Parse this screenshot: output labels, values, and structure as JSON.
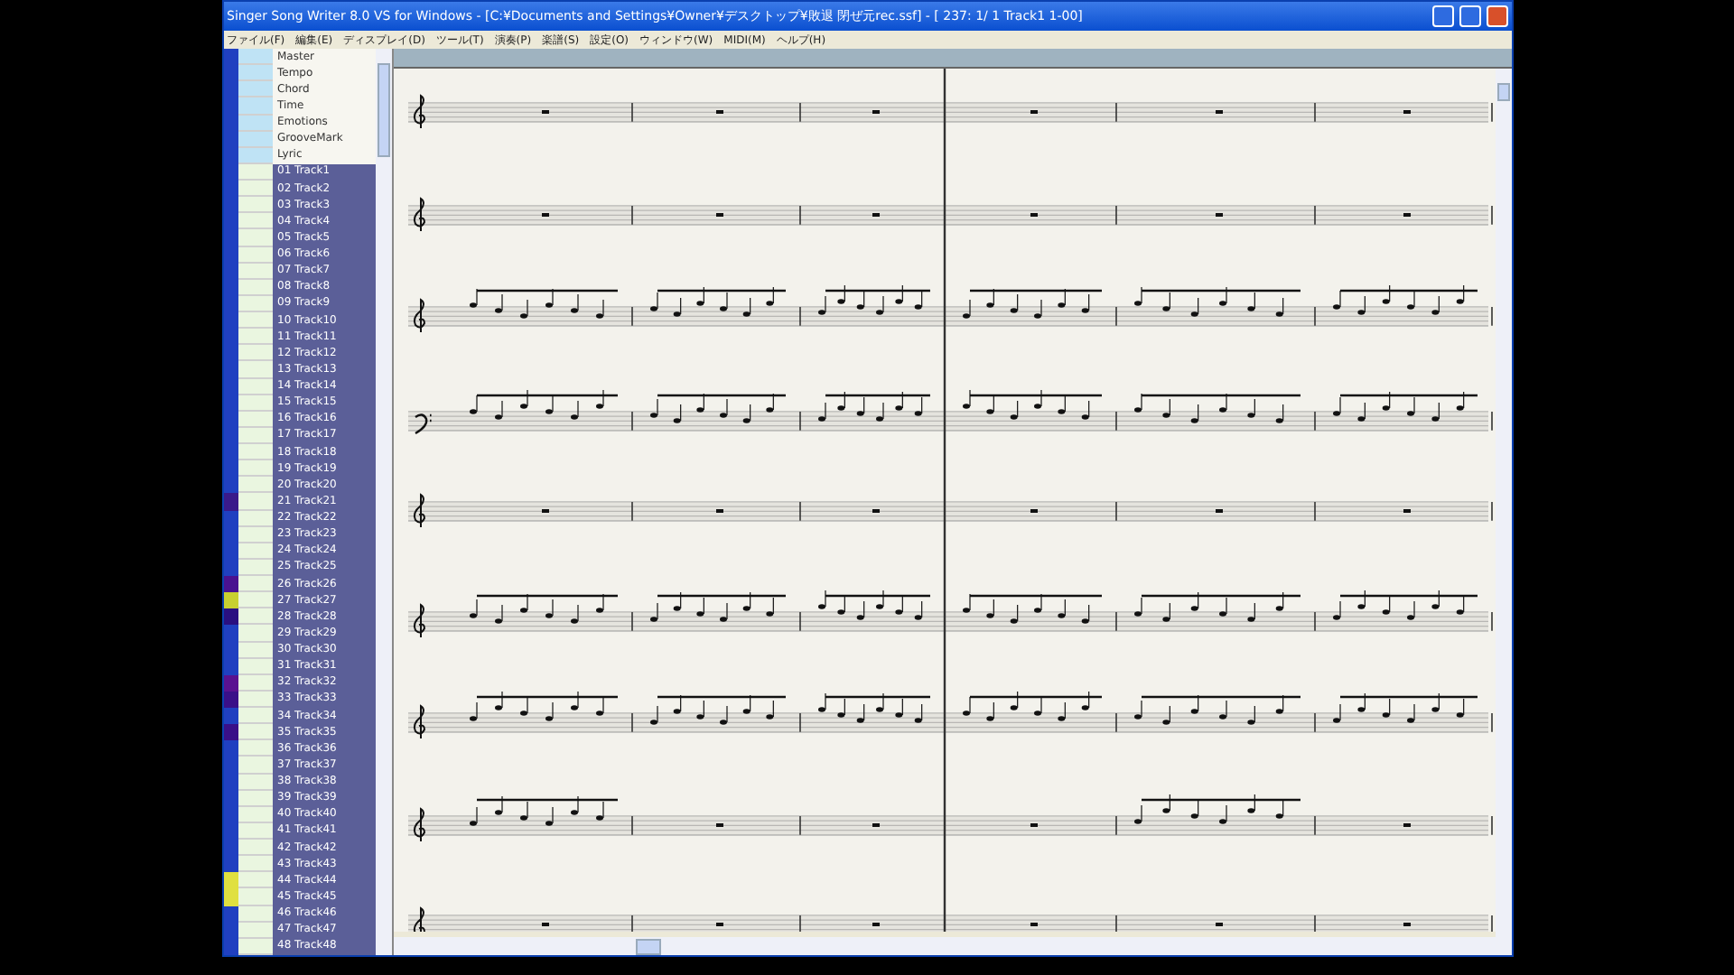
{
  "window": {
    "title": "Singer Song Writer 8.0 VS for Windows - [C:¥Documents and Settings¥Owner¥デスクトップ¥敗退 閉ぜ元rec.ssf] - [ 237: 1/ 1 Track1 1-00]"
  },
  "menu": [
    "ファイル(F)",
    "編集(E)",
    "ディスプレイ(D)",
    "ツール(T)",
    "演奏(P)",
    "楽譜(S)",
    "設定(O)",
    "ウィンドウ(W)",
    "MIDI(M)",
    "ヘルプ(H)"
  ],
  "track_list": {
    "meta": [
      "Master",
      "Tempo",
      "Chord",
      "Time",
      "Emotions",
      "GrooveMark",
      "Lyric"
    ],
    "tracks": [
      {
        "name": "01 Track1"
      },
      {
        "name": "02 Track2"
      },
      {
        "name": "03 Track3"
      },
      {
        "name": "04 Track4"
      },
      {
        "name": "05 Track5"
      },
      {
        "name": "06 Track6"
      },
      {
        "name": "07 Track7"
      },
      {
        "name": "08 Track8"
      },
      {
        "name": "09 Track9"
      },
      {
        "name": "10 Track10"
      },
      {
        "name": "11 Track11"
      },
      {
        "name": "12 Track12"
      },
      {
        "name": "13 Track13"
      },
      {
        "name": "14 Track14"
      },
      {
        "name": "15 Track15"
      },
      {
        "name": "16 Track16"
      },
      {
        "name": "17 Track17"
      },
      {
        "name": "18 Track18"
      },
      {
        "name": "19 Track19"
      },
      {
        "name": "20 Track20"
      },
      {
        "name": "21 Track21",
        "color": "#3a1a8a"
      },
      {
        "name": "22 Track22"
      },
      {
        "name": "23 Track23"
      },
      {
        "name": "24 Track24"
      },
      {
        "name": "25 Track25"
      },
      {
        "name": "26 Track26",
        "color": "#4a1290"
      },
      {
        "name": "27 Track27",
        "color": "#c8d030"
      },
      {
        "name": "28 Track28",
        "color": "#2a1080"
      },
      {
        "name": "29 Track29"
      },
      {
        "name": "30 Track30"
      },
      {
        "name": "31 Track31"
      },
      {
        "name": "32 Track32",
        "color": "#5a1290"
      },
      {
        "name": "33 Track33",
        "color": "#3a1088"
      },
      {
        "name": "34 Track34"
      },
      {
        "name": "35 Track35",
        "color": "#3a1088"
      },
      {
        "name": "36 Track36"
      },
      {
        "name": "37 Track37"
      },
      {
        "name": "38 Track38"
      },
      {
        "name": "39 Track39"
      },
      {
        "name": "40 Track40"
      },
      {
        "name": "41 Track41"
      },
      {
        "name": "42 Track42"
      },
      {
        "name": "43 Track43"
      },
      {
        "name": "44 Track44",
        "color": "#e0e040"
      },
      {
        "name": "45 Track45",
        "color": "#e0e040"
      },
      {
        "name": "46 Track46"
      },
      {
        "name": "47 Track47"
      },
      {
        "name": "48 Track48"
      }
    ]
  }
}
